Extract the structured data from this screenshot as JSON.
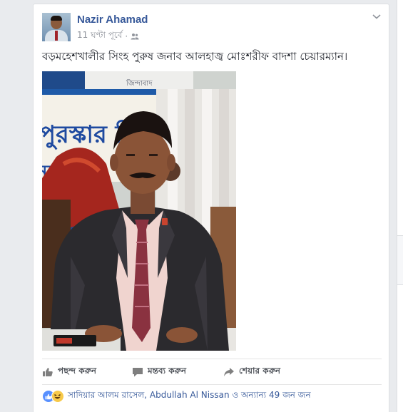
{
  "post": {
    "author": "Nazir Ahamad",
    "timestamp": "11 ঘণ্টা পূর্বে",
    "audience_icon": "friends-icon",
    "text": "বড়মহেশখালীর সিংহ পুরুষ জনাব আলহাজ্ব মোঃশরীফ বাদশা চেয়ারম্যান।",
    "photo_banner_text": "জিন্দাবাদ",
    "photo_banner_side": "পুরস্কার বি",
    "photo_banner_side2": "নর্"
  },
  "actions": {
    "like": "পছন্দ করুন",
    "comment": "মন্তব্য করুন",
    "share": "শেয়ার করুন"
  },
  "reactions": {
    "names": "সাদিয়ার আলম রাসেল, Abdullah Al Nissan ও অন্যান্য 49 জন জন",
    "icons": [
      "like-reaction-icon",
      "haha-reaction-icon"
    ]
  },
  "colors": {
    "link": "#365899",
    "text": "#1d2129",
    "muted": "#90949c",
    "background": "#e9ebee"
  }
}
